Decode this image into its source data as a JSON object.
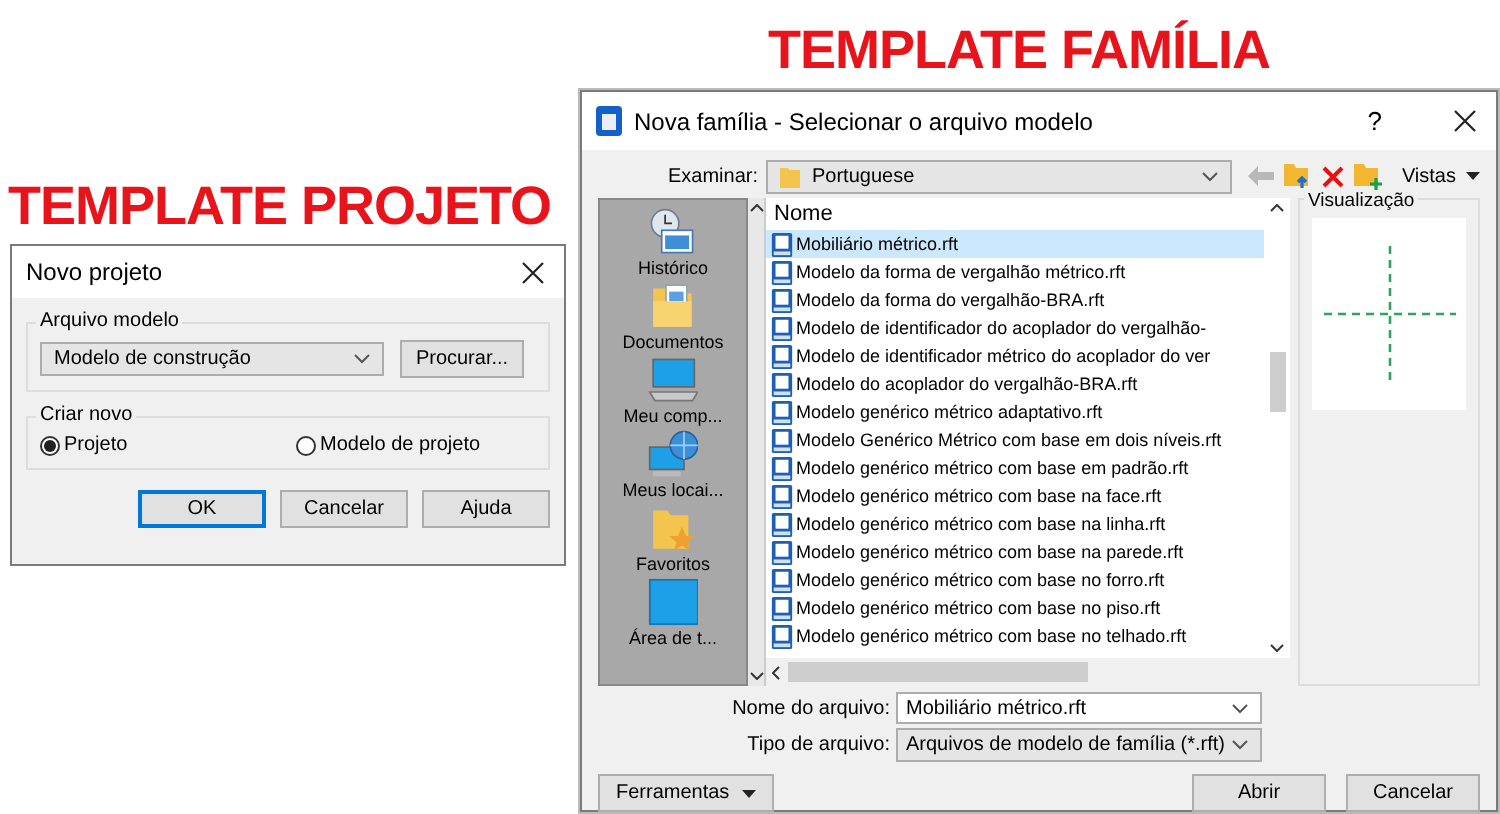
{
  "project_template": {
    "caption": "TEMPLATE PROJETO",
    "dialog": {
      "title": "Novo projeto",
      "template_group": {
        "label": "Arquivo modelo",
        "value": "Modelo de construção",
        "browse_button": "Procurar..."
      },
      "create_group": {
        "label": "Criar novo",
        "options": [
          {
            "label": "Projeto",
            "selected": true
          },
          {
            "label": "Modelo de projeto",
            "selected": false
          }
        ]
      },
      "buttons": [
        {
          "label": "OK",
          "focused": true
        },
        {
          "label": "Cancelar",
          "focused": false
        },
        {
          "label": "Ajuda",
          "focused": false
        }
      ]
    }
  },
  "family_template": {
    "caption": "TEMPLATE FAMÍLIA",
    "dialog": {
      "title": "Nova família - Selecionar o arquivo modelo",
      "help_button": "?",
      "look_in": {
        "label": "Examinar:",
        "value": "Portuguese"
      },
      "views_button": "Vistas",
      "places": [
        {
          "kind": "history",
          "label": "Histórico"
        },
        {
          "kind": "documents",
          "label": "Documentos"
        },
        {
          "kind": "computer",
          "label": "Meu comp..."
        },
        {
          "kind": "network",
          "label": "Meus locai..."
        },
        {
          "kind": "favorites",
          "label": "Favoritos"
        },
        {
          "kind": "desktop",
          "label": "Área de t..."
        }
      ],
      "list_header": "Nome",
      "files": [
        {
          "name": "Mobiliário métrico.rft",
          "selected": true
        },
        {
          "name": "Modelo da forma de vergalhão métrico.rft",
          "selected": false
        },
        {
          "name": "Modelo da forma do vergalhão-BRA.rft",
          "selected": false
        },
        {
          "name": "Modelo de identificador do acoplador do vergalhão-",
          "selected": false
        },
        {
          "name": "Modelo de identificador métrico do acoplador do ver",
          "selected": false
        },
        {
          "name": "Modelo do acoplador do vergalhão-BRA.rft",
          "selected": false
        },
        {
          "name": "Modelo genérico métrico adaptativo.rft",
          "selected": false
        },
        {
          "name": "Modelo Genérico Métrico com base em dois níveis.rft",
          "selected": false
        },
        {
          "name": "Modelo genérico métrico com base em padrão.rft",
          "selected": false
        },
        {
          "name": "Modelo genérico métrico com base na face.rft",
          "selected": false
        },
        {
          "name": "Modelo genérico métrico com base na linha.rft",
          "selected": false
        },
        {
          "name": "Modelo genérico métrico com base na parede.rft",
          "selected": false
        },
        {
          "name": "Modelo genérico métrico com base no forro.rft",
          "selected": false
        },
        {
          "name": "Modelo genérico métrico com base no piso.rft",
          "selected": false
        },
        {
          "name": "Modelo genérico métrico com base no telhado.rft",
          "selected": false
        }
      ],
      "preview_label": "Visualização",
      "file_name": {
        "label": "Nome do arquivo:",
        "value": "Mobiliário métrico.rft"
      },
      "file_type": {
        "label": "Tipo de arquivo:",
        "value": "Arquivos de modelo de família  (*.rft)"
      },
      "tools_button": "Ferramentas",
      "buttons": [
        {
          "label": "Abrir",
          "focused": false
        },
        {
          "label": "Cancelar",
          "focused": false
        }
      ]
    }
  }
}
